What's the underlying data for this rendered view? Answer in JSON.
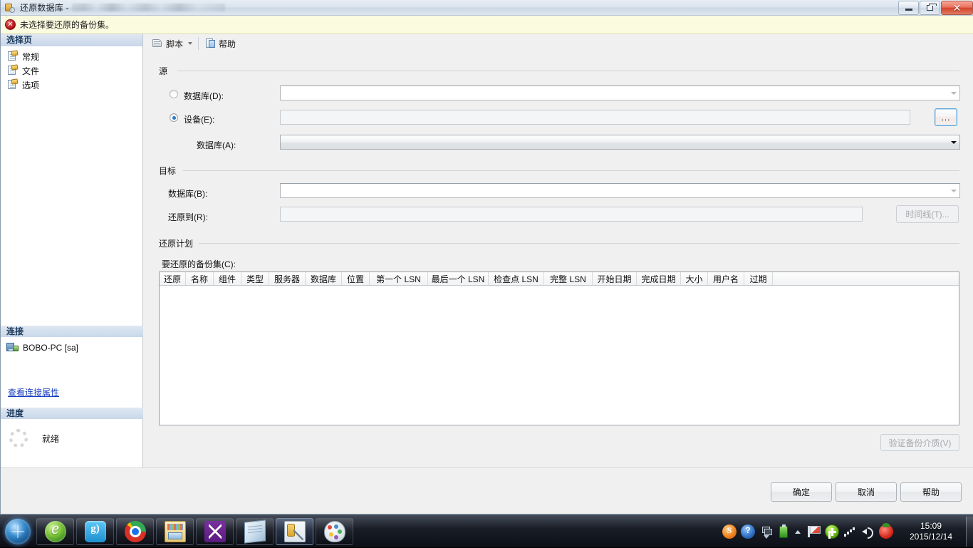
{
  "window": {
    "title": "还原数据库 -",
    "title_icon": "database-restore-icon",
    "controls": {
      "minimize": "minimize-button",
      "restore": "restore-button",
      "close": "✕"
    }
  },
  "error_bar": {
    "icon": "error-icon",
    "icon_glyph": "✕",
    "message": "未选择要还原的备份集。",
    "background": "#fbfbdf"
  },
  "sidebar": {
    "select_page_header": "选择页",
    "items": [
      {
        "label": "常规",
        "icon": "page-icon"
      },
      {
        "label": "文件",
        "icon": "page-icon"
      },
      {
        "label": "选项",
        "icon": "page-icon"
      }
    ],
    "connection_header": "连接",
    "connection_server": "BOBO-PC [sa]",
    "connection_link": "查看连接属性",
    "progress_header": "进度",
    "progress_status": "就绪"
  },
  "toolbar": {
    "script_label": "脚本",
    "help_label": "帮助"
  },
  "source": {
    "group_title": "源",
    "database_radio_label": "数据库(D):",
    "database_radio_selected": false,
    "device_radio_label": "设备(E):",
    "device_radio_selected": true,
    "device_browse_label": "...",
    "source_database_label": "数据库(A):",
    "database_value": "",
    "device_value": "",
    "source_database_value": ""
  },
  "target": {
    "group_title": "目标",
    "database_label": "数据库(B):",
    "database_value": "",
    "restore_to_label": "还原到(R):",
    "restore_to_value": "",
    "timeline_button": "时间线(T)..."
  },
  "restore_plan": {
    "group_title": "还原计划",
    "backup_sets_label": "要还原的备份集(C):",
    "columns": [
      "还原",
      "名称",
      "组件",
      "类型",
      "服务器",
      "数据库",
      "位置",
      "第一个 LSN",
      "最后一个 LSN",
      "检查点 LSN",
      "完整 LSN",
      "开始日期",
      "完成日期",
      "大小",
      "用户名",
      "过期"
    ],
    "rows": [],
    "verify_button": "验证备份介质(V)"
  },
  "dialog_buttons": {
    "ok": "确定",
    "cancel": "取消",
    "help": "帮助"
  },
  "taskbar": {
    "start": "start-orb",
    "apps": [
      {
        "name": "internet-explorer",
        "icon": "ie-icon"
      },
      {
        "name": "qq-browser",
        "icon": "qq-icon"
      },
      {
        "name": "google-chrome",
        "icon": "chrome-icon"
      },
      {
        "name": "windows-explorer",
        "icon": "explorer-icon"
      },
      {
        "name": "visual-studio",
        "icon": "visual-studio-icon"
      },
      {
        "name": "notepad",
        "icon": "notepad-icon"
      },
      {
        "name": "sql-server-management-studio",
        "icon": "sql-server-icon"
      },
      {
        "name": "paint",
        "icon": "paint-icon"
      }
    ],
    "tray": [
      {
        "name": "sogou-input",
        "icon": "sogou-icon"
      },
      {
        "name": "help-notification",
        "icon": "help-icon"
      },
      {
        "name": "window-switcher",
        "icon": "window-icon"
      },
      {
        "name": "usb-device",
        "icon": "usb-icon"
      },
      {
        "name": "action-center",
        "icon": "flag-icon"
      },
      {
        "name": "update-agent",
        "icon": "green-plus-icon"
      },
      {
        "name": "network",
        "icon": "signal-icon"
      },
      {
        "name": "volume",
        "icon": "speaker-icon"
      },
      {
        "name": "tomato-timer",
        "icon": "tomato-icon"
      }
    ],
    "clock_time": "15:09",
    "clock_date": "2015/12/14"
  }
}
